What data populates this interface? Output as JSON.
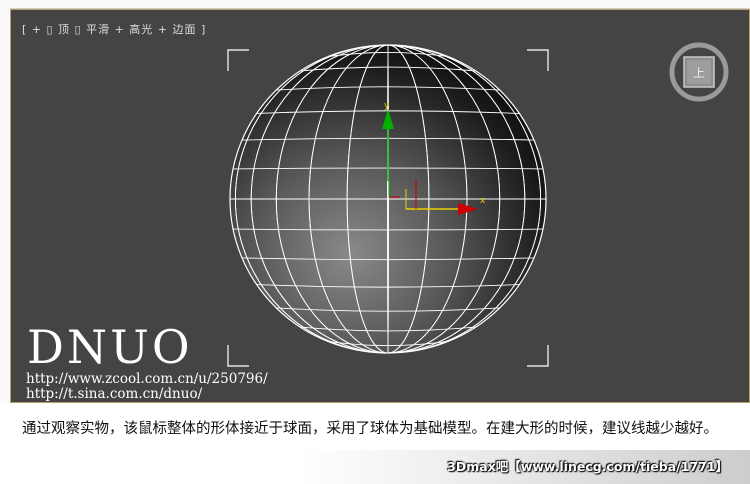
{
  "viewport": {
    "label": "[ + ▯ 顶 ▯ 平滑 + 高光 + 边面 ]",
    "viewcube_face": "上",
    "axis_x_label": "x",
    "axis_y_label": "y"
  },
  "watermark": {
    "title": "DNUO",
    "url1": "http://www.zcool.com.cn/u/250796/",
    "url2": "http://t.sina.com.cn/dnuo/"
  },
  "description": "通过观察实物，该鼠标整体的形体接近于球面，采用了球体为基础模型。在建大形的时候，建议线越少越好。",
  "footer": "3Dmax吧【www.linecg.com/tieba/1771】",
  "colors": {
    "viewport_bg": "#444444",
    "wire": "#ffffff",
    "axis_x": "#e8d000",
    "axis_y": "#00b000",
    "axis_z": "#cc0000",
    "viewport_border": "#b8a062"
  }
}
